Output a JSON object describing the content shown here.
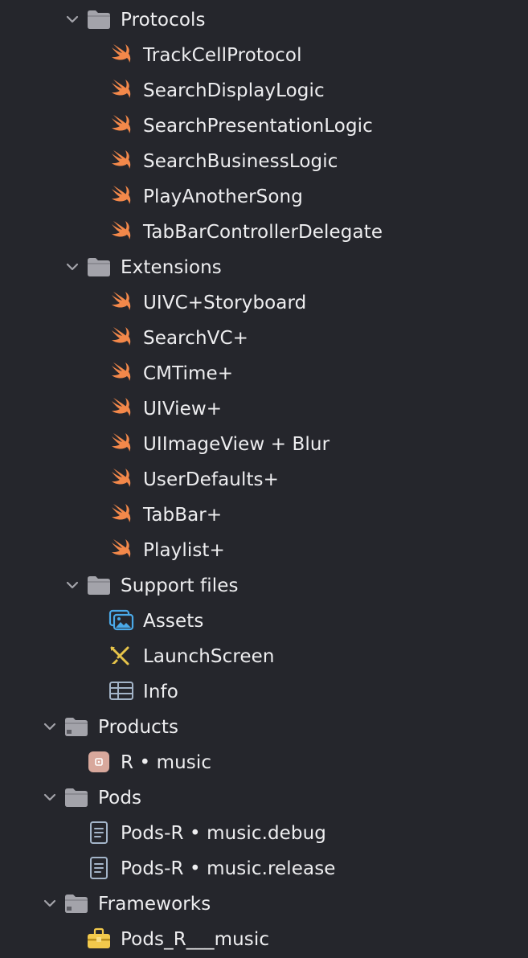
{
  "accent_colors": {
    "swift": "#f3884a",
    "folder": "#a3a3aa",
    "assets": "#4aa9e8",
    "storyboard": "#e7c44a",
    "product": "#d8a89c",
    "framework": "#f2c94c",
    "text": "#eeeef0",
    "background": "#25262c"
  },
  "tree": {
    "protocols_group": {
      "label": "Protocols",
      "expanded": true,
      "icon": "folder-icon",
      "files": [
        {
          "label": "TrackCellProtocol",
          "icon": "swift-file-icon"
        },
        {
          "label": "SearchDisplayLogic",
          "icon": "swift-file-icon"
        },
        {
          "label": "SearchPresentationLogic",
          "icon": "swift-file-icon"
        },
        {
          "label": "SearchBusinessLogic",
          "icon": "swift-file-icon"
        },
        {
          "label": "PlayAnotherSong",
          "icon": "swift-file-icon"
        },
        {
          "label": "TabBarControllerDelegate",
          "icon": "swift-file-icon"
        }
      ]
    },
    "extensions_group": {
      "label": "Extensions",
      "expanded": true,
      "icon": "folder-icon",
      "files": [
        {
          "label": "UIVC+Storyboard",
          "icon": "swift-file-icon"
        },
        {
          "label": "SearchVC+",
          "icon": "swift-file-icon"
        },
        {
          "label": "CMTime+",
          "icon": "swift-file-icon"
        },
        {
          "label": "UIView+",
          "icon": "swift-file-icon"
        },
        {
          "label": "UIImageView + Blur",
          "icon": "swift-file-icon"
        },
        {
          "label": "UserDefaults+",
          "icon": "swift-file-icon"
        },
        {
          "label": "TabBar+",
          "icon": "swift-file-icon"
        },
        {
          "label": "Playlist+",
          "icon": "swift-file-icon"
        }
      ]
    },
    "support_group": {
      "label": "Support files",
      "expanded": true,
      "icon": "folder-icon",
      "files": [
        {
          "label": "Assets",
          "icon": "asset-catalog-icon"
        },
        {
          "label": "LaunchScreen",
          "icon": "storyboard-icon"
        },
        {
          "label": "Info",
          "icon": "plist-icon"
        }
      ]
    },
    "products_group": {
      "label": "Products",
      "expanded": true,
      "icon": "folder-icon",
      "files": [
        {
          "label": "R • music",
          "icon": "app-product-icon"
        }
      ]
    },
    "pods_group": {
      "label": "Pods",
      "expanded": true,
      "icon": "folder-icon",
      "files": [
        {
          "label": "Pods-R • music.debug",
          "icon": "xcconfig-file-icon"
        },
        {
          "label": "Pods-R • music.release",
          "icon": "xcconfig-file-icon"
        }
      ]
    },
    "frameworks_group": {
      "label": "Frameworks",
      "expanded": true,
      "icon": "folder-icon",
      "files": [
        {
          "label": "Pods_R___music",
          "icon": "framework-toolbox-icon"
        }
      ]
    }
  }
}
